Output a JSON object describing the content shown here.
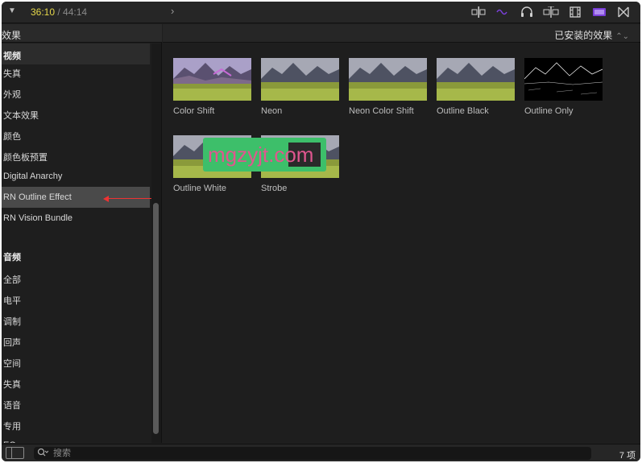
{
  "toolbar": {
    "timecode_current": "36:10",
    "timecode_sep": " / ",
    "timecode_total": "44:14",
    "icons": [
      "skimming-icon",
      "audio-skimming-icon",
      "headphones-icon",
      "snapping-icon",
      "video-inspector-icon",
      "effects-browser-icon",
      "transitions-icon"
    ],
    "active_color": "#9b59ff"
  },
  "left_panel": {
    "title": "效果",
    "sections": [
      {
        "label": "视频",
        "items": [
          {
            "label": "失真"
          },
          {
            "label": "外观"
          },
          {
            "label": "文本效果"
          },
          {
            "label": "颜色"
          },
          {
            "label": "颜色板预置"
          },
          {
            "label": "Digital Anarchy"
          },
          {
            "label": "RN Outline Effect",
            "selected": true
          },
          {
            "label": "RN Vision Bundle"
          }
        ]
      },
      {
        "label": "音频",
        "items": [
          {
            "label": "全部"
          },
          {
            "label": "电平"
          },
          {
            "label": "调制"
          },
          {
            "label": "回声"
          },
          {
            "label": "空间"
          },
          {
            "label": "失真"
          },
          {
            "label": "语音"
          },
          {
            "label": "专用"
          },
          {
            "label": "EQ"
          }
        ]
      }
    ]
  },
  "right_panel": {
    "filter_label": "已安装的效果",
    "effects": [
      {
        "name": "Color Shift"
      },
      {
        "name": "Neon"
      },
      {
        "name": "Neon Color Shift"
      },
      {
        "name": "Outline Black"
      },
      {
        "name": "Outline Only"
      },
      {
        "name": "Outline White"
      },
      {
        "name": "Strobe"
      }
    ],
    "watermark": "mgzyjt.com"
  },
  "bottom_bar": {
    "search_placeholder": "搜索",
    "item_count": "7 项"
  }
}
